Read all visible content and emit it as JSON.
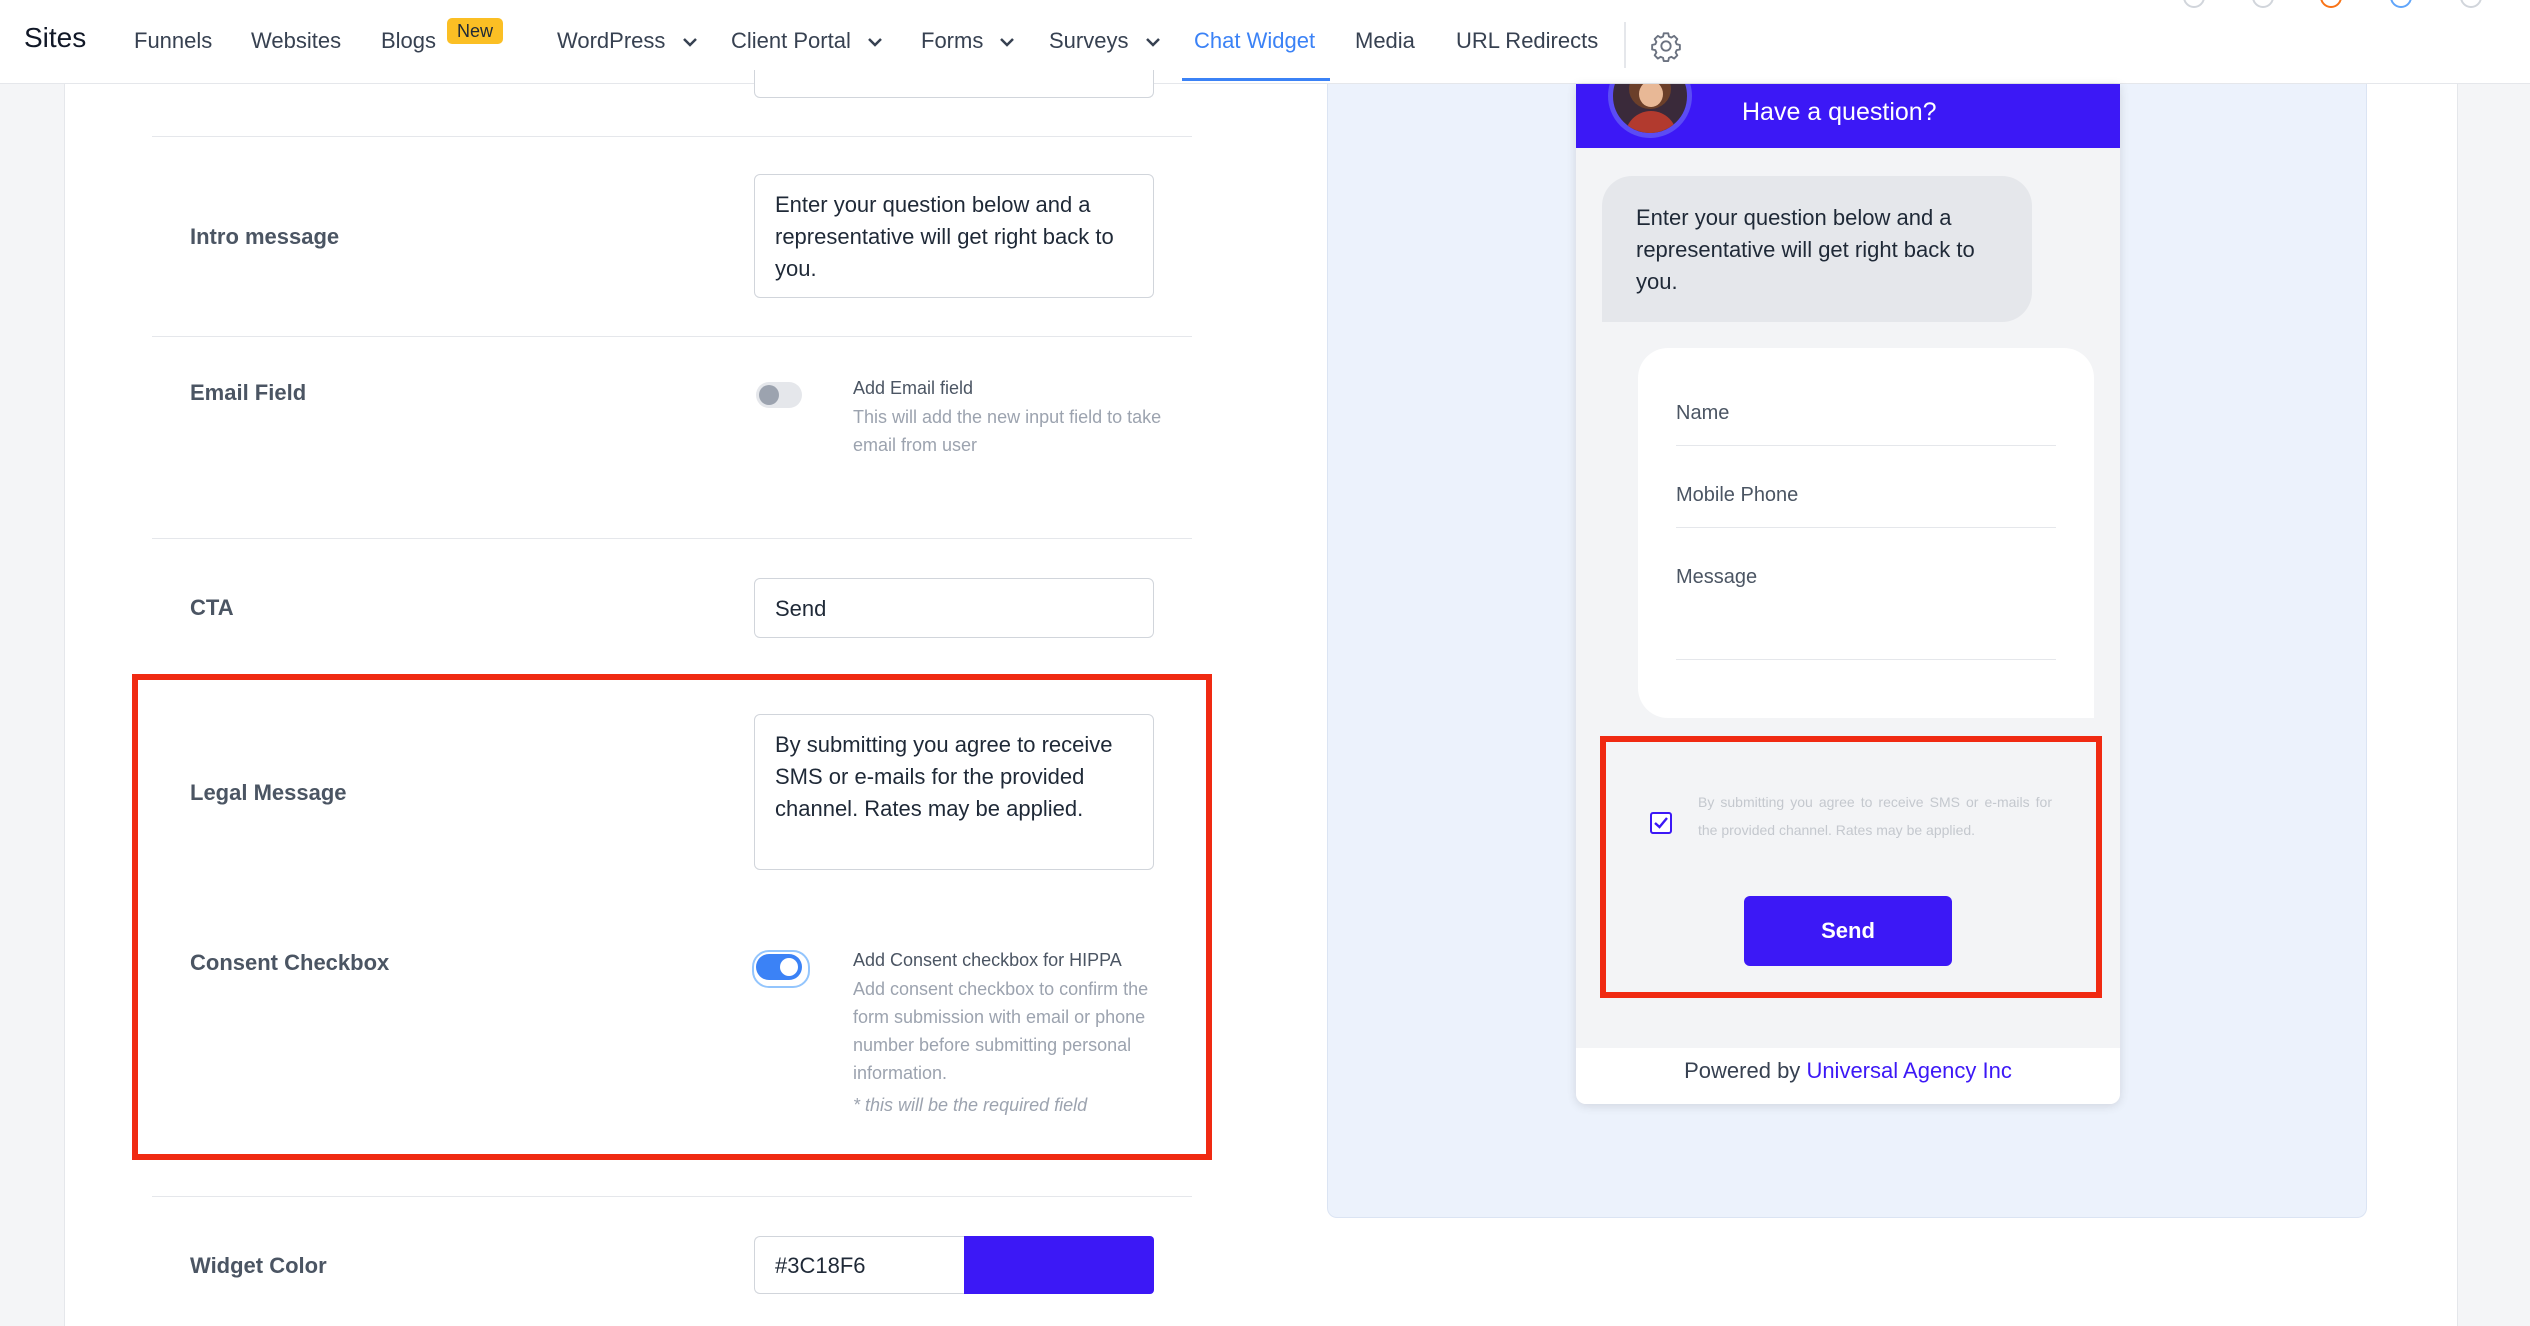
{
  "nav": {
    "brand": "Sites",
    "items": [
      {
        "label": "Funnels",
        "dropdown": false
      },
      {
        "label": "Websites",
        "dropdown": false
      },
      {
        "label": "Blogs",
        "dropdown": false,
        "badge": "New"
      },
      {
        "label": "WordPress",
        "dropdown": true
      },
      {
        "label": "Client Portal",
        "dropdown": true
      },
      {
        "label": "Forms",
        "dropdown": true
      },
      {
        "label": "Surveys",
        "dropdown": true
      },
      {
        "label": "Chat Widget",
        "dropdown": false,
        "active": true
      },
      {
        "label": "Media",
        "dropdown": false
      },
      {
        "label": "URL Redirects",
        "dropdown": false
      }
    ],
    "settings_icon": "gear-icon"
  },
  "settings": {
    "intro_label": "Intro message",
    "intro_value": "Enter your question below and a representative will get right back to you.",
    "email_label": "Email Field",
    "email_toggle_title": "Add Email field",
    "email_toggle_desc": "This will add the new input field to take email from user",
    "email_toggle_on": false,
    "cta_label": "CTA",
    "cta_value": "Send",
    "legal_label": "Legal Message",
    "legal_value": "By submitting you agree to receive SMS or e-mails for the provided channel. Rates may be applied.",
    "consent_label": "Consent Checkbox",
    "consent_toggle_title": "Add Consent checkbox for HIPPA",
    "consent_toggle_desc": "Add consent checkbox to confirm the form submission with email or phone number before submitting personal information.",
    "consent_toggle_note": "* this will be the required field",
    "consent_toggle_on": true,
    "color_label": "Widget Color",
    "color_value": "#3C18F6"
  },
  "preview": {
    "header_title": "Have a question?",
    "bubble_text": "Enter your question below and a representative will get right back to you.",
    "fields": [
      "Name",
      "Mobile Phone",
      "Message"
    ],
    "consent_checked": true,
    "consent_text": "By submitting you agree to receive SMS or e-mails for the provided channel. Rates may be applied.",
    "send_label": "Send",
    "powered_prefix": "Powered by",
    "powered_agency": "Universal Agency Inc"
  },
  "colors": {
    "accent": "#3b82f6",
    "widget": "#3C18F6",
    "highlight": "#f02a12",
    "badge": "#fbbf24"
  }
}
